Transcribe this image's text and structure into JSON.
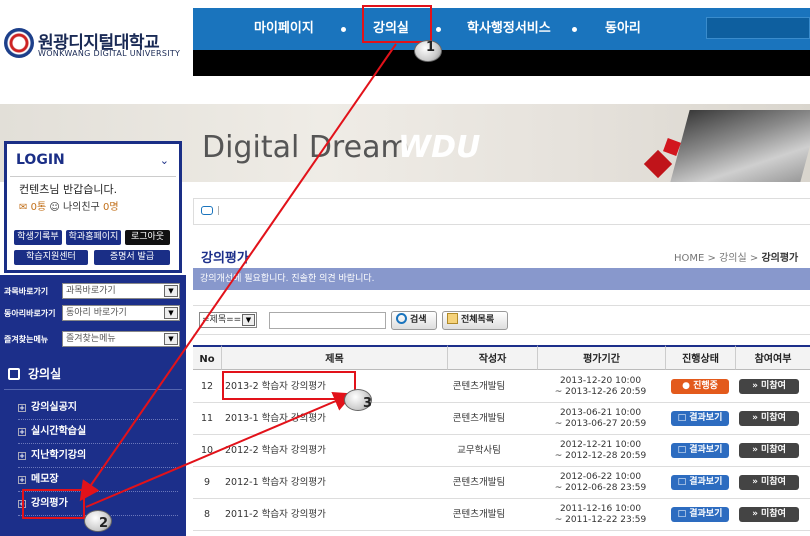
{
  "brand": {
    "name_kr": "원광디지털대학교",
    "name_en": "WONKWANG DIGITAL UNIVERSITY"
  },
  "topnav": {
    "items": [
      "마이페이지",
      "강의실",
      "학사행정서비스",
      "동아리"
    ]
  },
  "banner": {
    "title": "Digital Dream",
    "logo": "WDU"
  },
  "login": {
    "heading": "LOGIN",
    "greeting": "컨텐츠님 반갑습니다.",
    "mail": "0통",
    "friends_label": "나의친구",
    "friends": "0명",
    "buttons": [
      "학생기록부",
      "학과홈페이지",
      "로그아웃",
      "학습지원센터",
      "증명서 발급"
    ]
  },
  "quicklinks": [
    {
      "label": "과목바로가기",
      "value": "과목바로가기"
    },
    {
      "label": "동아리바로가기",
      "value": "동아리 바로가기"
    },
    {
      "label": "즐겨찾는메뉴",
      "value": "즐겨찾는메뉴"
    }
  ],
  "sidemenu": {
    "heading": "강의실",
    "items": [
      "강의실공지",
      "실시간학습실",
      "지난학기강의",
      "메모장",
      "강의평가"
    ]
  },
  "page": {
    "title": "강의평가",
    "breadcrumb": {
      "home": "HOME",
      "section": "강의실",
      "current": "강의평가"
    },
    "notice": "강의개선에 필요합니다. 진솔한 의견 바랍니다."
  },
  "search": {
    "field": "=제목==",
    "search_button": "검색",
    "all_button": "전체목록"
  },
  "table": {
    "headers": [
      "No",
      "제목",
      "작성자",
      "평가기간",
      "진행상태",
      "참여여부"
    ],
    "rows": [
      {
        "no": "12",
        "title": "2013-2 학습자 강의평가",
        "author": "콘텐츠개발팀",
        "start": "2013-12-20 10:00",
        "end": "~ 2013-12-26 20:59",
        "status": "진행중",
        "status_type": "progress",
        "participation": "» 미참여"
      },
      {
        "no": "11",
        "title": "2013-1 학습자 강의평가",
        "author": "콘텐츠개발팀",
        "start": "2013-06-21 10:00",
        "end": "~ 2013-06-27 20:59",
        "status": "결과보기",
        "status_type": "result",
        "participation": "» 미참여"
      },
      {
        "no": "10",
        "title": "2012-2 학습자 강의평가",
        "author": "교무학사팀",
        "start": "2012-12-21 10:00",
        "end": "~ 2012-12-28 20:59",
        "status": "결과보기",
        "status_type": "result",
        "participation": "» 미참여"
      },
      {
        "no": "9",
        "title": "2012-1 학습자 강의평가",
        "author": "콘텐츠개발팀",
        "start": "2012-06-22 10:00",
        "end": "~ 2012-06-28 23:59",
        "status": "결과보기",
        "status_type": "result",
        "participation": "» 미참여"
      },
      {
        "no": "8",
        "title": "2011-2 학습자 강의평가",
        "author": "콘텐츠개발팀",
        "start": "2011-12-16 10:00",
        "end": "~ 2011-12-22 23:59",
        "status": "결과보기",
        "status_type": "result",
        "participation": "» 미참여"
      }
    ]
  },
  "annotations": {
    "steps": [
      "1",
      "2",
      "3"
    ],
    "color": "#e2121a"
  }
}
